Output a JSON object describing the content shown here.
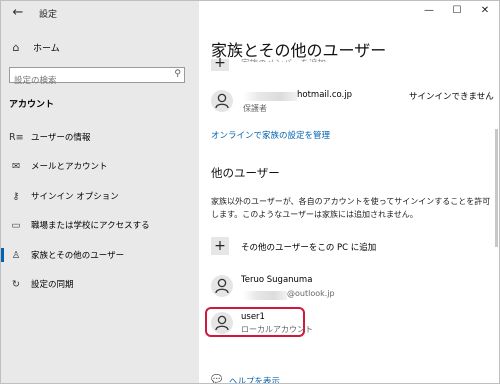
{
  "window": {
    "back_icon": "back-arrow-icon",
    "app_title": "設定",
    "controls": [
      "—",
      "☐",
      "✕"
    ]
  },
  "sidebar": {
    "home_label": "ホーム",
    "search_placeholder": "設定の検索",
    "section_heading": "アカウント",
    "items": [
      {
        "label": "ユーザーの情報",
        "icon": "person-card-icon"
      },
      {
        "label": "メールとアカウント",
        "icon": "mail-icon"
      },
      {
        "label": "サインイン オプション",
        "icon": "key-icon"
      },
      {
        "label": "職場または学校にアクセスする",
        "icon": "briefcase-icon"
      },
      {
        "label": "家族とその他のユーザー",
        "icon": "family-icon",
        "selected": true
      },
      {
        "label": "設定の同期",
        "icon": "sync-icon"
      }
    ]
  },
  "main": {
    "title": "家族とその他のユーザー",
    "faded_add_label": "家族のメンバーを追加",
    "family_member": {
      "email_suffix": "hotmail.co.jp",
      "role": "保護者",
      "status": "サインインできません"
    },
    "online_link": "オンラインで家族の設定を管理",
    "other_users_heading": "他のユーザー",
    "other_users_desc": "家族以外のユーザーが、各自のアカウントを使ってサインインすることを許可します。このようなユーザーは家族には追加されません。",
    "add_other_label": "その他のユーザーをこの PC に追加",
    "users": [
      {
        "name": "Teruo Suganuma",
        "sub": "@outlook.jp"
      },
      {
        "name": "user1",
        "sub": "ローカルアカウント"
      }
    ],
    "help_link": "ヘルプを表示"
  },
  "colors": {
    "accent": "#0063b1",
    "highlight": "#d0183c",
    "sidebar_bg": "#e9e9e9"
  }
}
